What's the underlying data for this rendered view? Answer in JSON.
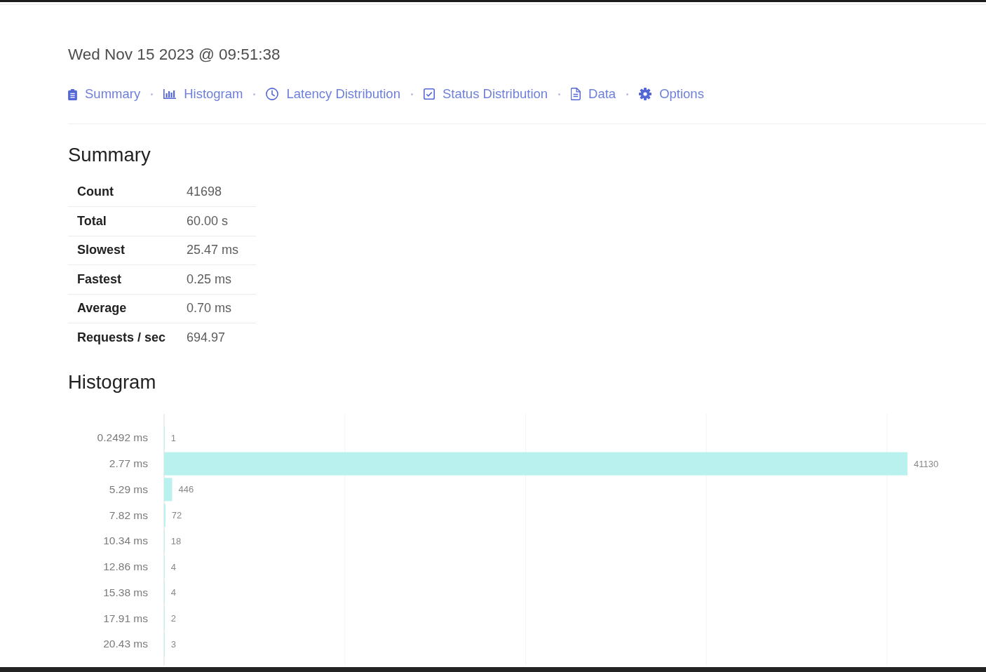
{
  "header": {
    "title": "Wed Nov 15 2023 @ 09:51:38"
  },
  "nav": {
    "links": [
      {
        "label": "Summary",
        "kind": "summary"
      },
      {
        "label": "Histogram",
        "kind": "histogram"
      },
      {
        "label": "Latency Distribution",
        "kind": "latency"
      },
      {
        "label": "Status Distribution",
        "kind": "status"
      },
      {
        "label": "Data",
        "kind": "data"
      },
      {
        "label": "Options",
        "kind": "options"
      }
    ]
  },
  "summary": {
    "title": "Summary",
    "rows": [
      {
        "label": "Count",
        "value": "41698"
      },
      {
        "label": "Total",
        "value": "60.00 s"
      },
      {
        "label": "Slowest",
        "value": "25.47 ms"
      },
      {
        "label": "Fastest",
        "value": "0.25 ms"
      },
      {
        "label": "Average",
        "value": "0.70 ms"
      },
      {
        "label": "Requests / sec",
        "value": "694.97"
      }
    ]
  },
  "histogram": {
    "title": "Histogram",
    "chart_data": {
      "type": "bar",
      "orientation": "horizontal",
      "categories": [
        "0.2492 ms",
        "2.77 ms",
        "5.29 ms",
        "7.82 ms",
        "10.34 ms",
        "12.86 ms",
        "15.38 ms",
        "17.91 ms",
        "20.43 ms"
      ],
      "values": [
        1,
        41130,
        446,
        72,
        18,
        4,
        4,
        2,
        3
      ],
      "data_labels": true
    }
  }
}
